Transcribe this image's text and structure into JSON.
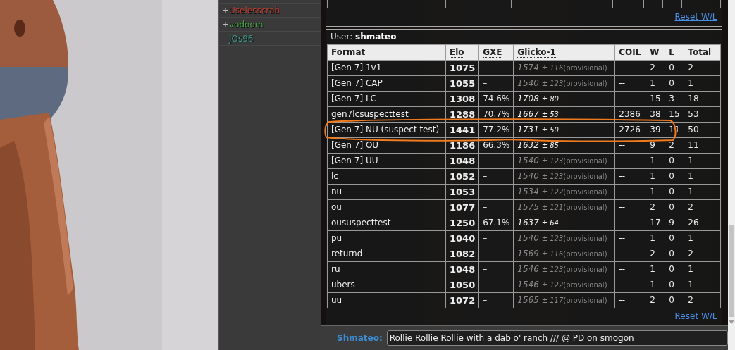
{
  "userlist": [
    {
      "rank": "+",
      "name": "Uselesscrab",
      "color": "#c0392b"
    },
    {
      "rank": "+",
      "name": "vodoom",
      "color": "#3fa63f"
    },
    {
      "name": "JOs96",
      "color": "#3a9a8a"
    }
  ],
  "previous_table": {
    "reset_link": "Reset W/L"
  },
  "ladder": {
    "user_label": "User:",
    "username": "shmateo",
    "columns": [
      {
        "label": "Format",
        "abbr": false
      },
      {
        "label": "Elo",
        "abbr": true
      },
      {
        "label": "GXE",
        "abbr": true
      },
      {
        "label": "Glicko-1",
        "abbr": true
      },
      {
        "label": "COIL",
        "abbr": false
      },
      {
        "label": "W",
        "abbr": false
      },
      {
        "label": "L",
        "abbr": false
      },
      {
        "label": "Total",
        "abbr": false
      }
    ],
    "rows": [
      {
        "format": "[Gen 7] 1v1",
        "elo": "1075",
        "gxe": "–",
        "rating": "1574",
        "deviation": "± 116",
        "note": "(provisional)",
        "provisional": true,
        "coil": "--",
        "w": "2",
        "l": "0",
        "total": "2"
      },
      {
        "format": "[Gen 7] CAP",
        "elo": "1055",
        "gxe": "–",
        "rating": "1540",
        "deviation": "± 123",
        "note": "(provisional)",
        "provisional": true,
        "coil": "--",
        "w": "1",
        "l": "0",
        "total": "1"
      },
      {
        "format": "[Gen 7] LC",
        "elo": "1308",
        "gxe": "74.6%",
        "rating": "1708",
        "deviation": "± 80",
        "provisional": false,
        "coil": "--",
        "w": "15",
        "l": "3",
        "total": "18"
      },
      {
        "format": "gen7lcsuspecttest",
        "elo": "1288",
        "gxe": "70.7%",
        "rating": "1667",
        "deviation": "± 53",
        "provisional": false,
        "coil": "2386",
        "w": "38",
        "l": "15",
        "total": "53"
      },
      {
        "format": "[Gen 7] NU (suspect test)",
        "highlighted": true,
        "elo": "1441",
        "gxe": "77.2%",
        "rating": "1731",
        "deviation": "± 50",
        "provisional": false,
        "coil": "2726",
        "w": "39",
        "l": "11",
        "total": "50"
      },
      {
        "format": "[Gen 7] OU",
        "elo": "1186",
        "gxe": "66.3%",
        "rating": "1632",
        "deviation": "± 85",
        "provisional": false,
        "coil": "--",
        "w": "9",
        "l": "2",
        "total": "11"
      },
      {
        "format": "[Gen 7] UU",
        "elo": "1048",
        "gxe": "–",
        "rating": "1540",
        "deviation": "± 123",
        "note": "(provisional)",
        "provisional": true,
        "coil": "--",
        "w": "1",
        "l": "0",
        "total": "1"
      },
      {
        "format": "lc",
        "elo": "1052",
        "gxe": "–",
        "rating": "1540",
        "deviation": "± 123",
        "note": "(provisional)",
        "provisional": true,
        "coil": "--",
        "w": "1",
        "l": "0",
        "total": "1"
      },
      {
        "format": "nu",
        "elo": "1053",
        "gxe": "–",
        "rating": "1534",
        "deviation": "± 122",
        "note": "(provisional)",
        "provisional": true,
        "coil": "--",
        "w": "1",
        "l": "0",
        "total": "1"
      },
      {
        "format": "ou",
        "elo": "1077",
        "gxe": "–",
        "rating": "1575",
        "deviation": "± 121",
        "note": "(provisional)",
        "provisional": true,
        "coil": "--",
        "w": "2",
        "l": "0",
        "total": "2"
      },
      {
        "format": "oususpecttest",
        "elo": "1250",
        "gxe": "67.1%",
        "rating": "1637",
        "deviation": "± 64",
        "provisional": false,
        "coil": "--",
        "w": "17",
        "l": "9",
        "total": "26"
      },
      {
        "format": "pu",
        "elo": "1040",
        "gxe": "–",
        "rating": "1540",
        "deviation": "± 123",
        "note": "(provisional)",
        "provisional": true,
        "coil": "--",
        "w": "1",
        "l": "0",
        "total": "1"
      },
      {
        "format": "returnd",
        "elo": "1082",
        "gxe": "–",
        "rating": "1569",
        "deviation": "± 116",
        "note": "(provisional)",
        "provisional": true,
        "coil": "--",
        "w": "2",
        "l": "0",
        "total": "2"
      },
      {
        "format": "ru",
        "elo": "1048",
        "gxe": "–",
        "rating": "1546",
        "deviation": "± 123",
        "note": "(provisional)",
        "provisional": true,
        "coil": "--",
        "w": "1",
        "l": "0",
        "total": "1"
      },
      {
        "format": "ubers",
        "elo": "1050",
        "gxe": "–",
        "rating": "1546",
        "deviation": "± 122",
        "note": "(provisional)",
        "provisional": true,
        "coil": "--",
        "w": "1",
        "l": "0",
        "total": "1"
      },
      {
        "format": "uu",
        "elo": "1072",
        "gxe": "–",
        "rating": "1565",
        "deviation": "± 117",
        "note": "(provisional)",
        "provisional": true,
        "coil": "--",
        "w": "2",
        "l": "0",
        "total": "2"
      }
    ],
    "reset_link": "Reset W/L"
  },
  "chat": {
    "name": "Shmateo:",
    "value": "Rollie Rollie Rollie with a dab o' ranch /// @ PD on smogon"
  }
}
